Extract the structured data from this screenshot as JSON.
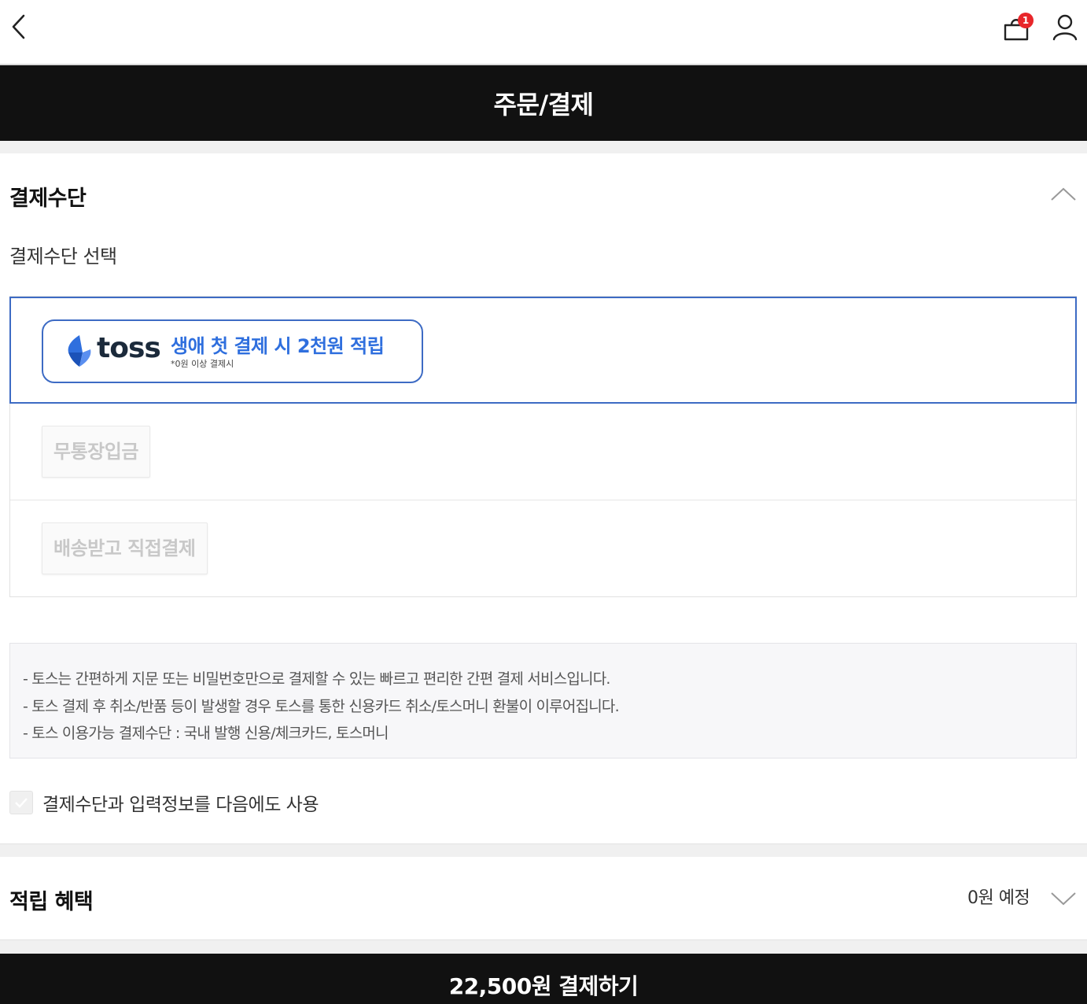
{
  "header": {
    "back_icon": "chevron-left-icon",
    "cart_icon": "shopping-bag-icon",
    "cart_count": "1",
    "user_icon": "user-icon",
    "badge_color": "#e8262a"
  },
  "title": "주문/결제",
  "payment": {
    "section_title": "결제수단",
    "select_label": "결제수단 선택",
    "toss": {
      "word": "toss",
      "promo": "생애 첫 결제 시 2천원 적립",
      "note": "*0원 이상 결제시",
      "accent_color": "#3d6bc4"
    },
    "methods": [
      "무통장입금",
      "배송받고 직접결제"
    ],
    "notice": [
      "- 토스는 간편하게 지문 또는 비밀번호만으로 결제할 수 있는 빠르고 편리한 간편 결제 서비스입니다.",
      "- 토스 결제 후 취소/반품 등이 발생할 경우 토스를 통한 신용카드 취소/토스머니 환불이 이루어집니다.",
      "- 토스 이용가능 결제수단 : 국내 발행 신용/체크카드, 토스머니"
    ],
    "save_label": "결제수단과 입력정보를 다음에도 사용"
  },
  "benefit": {
    "title": "적립 혜택",
    "value": "0원 예정"
  },
  "pay_button": "22,500원 결제하기"
}
